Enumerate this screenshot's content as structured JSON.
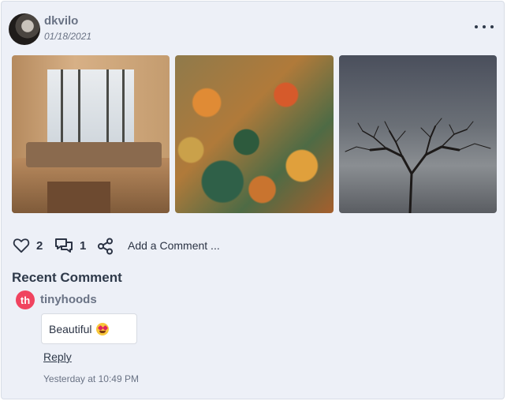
{
  "post": {
    "username": "dkvilo",
    "date": "01/18/2021",
    "menu_icon": "more-horizontal-icon",
    "photos": [
      {
        "subject": "cabin interior with winter window view"
      },
      {
        "subject": "autumn forest aerial"
      },
      {
        "subject": "bare tree under cloudy sky"
      }
    ]
  },
  "actions": {
    "likes": "2",
    "comments": "1",
    "add_comment": "Add a Comment ..."
  },
  "recent": {
    "heading": "Recent Comment",
    "avatar_initials": "th",
    "avatar_color": "#f0435f",
    "username": "tinyhoods",
    "text": "Beautiful",
    "emoji": "heart-eyes-emoji",
    "reply_label": "Reply",
    "time": "Yesterday at 10:49 PM"
  }
}
